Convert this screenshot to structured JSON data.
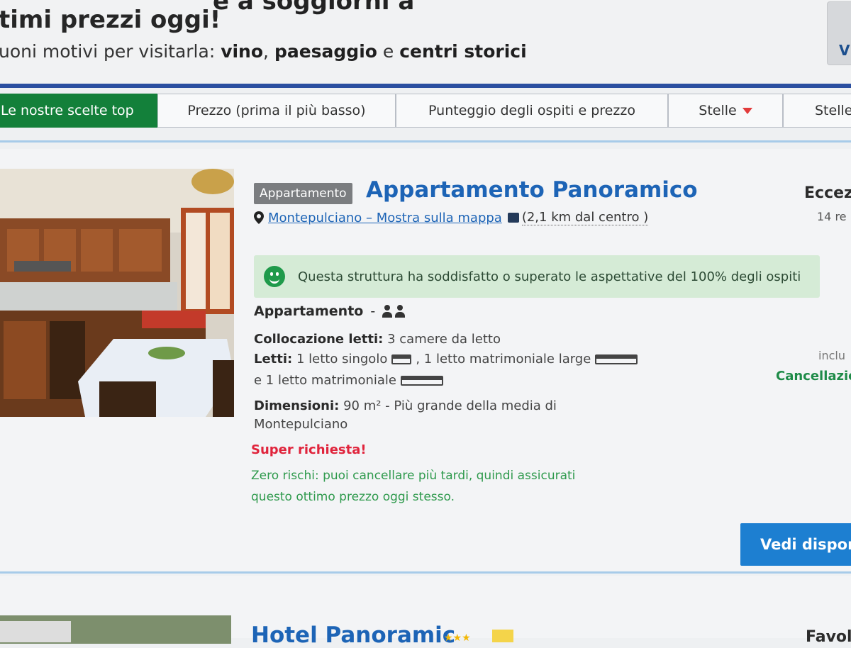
{
  "header": {
    "cut_line": "e a soggiorni a",
    "headline": "timi prezzi oggi!",
    "subline_prefix": "uoni motivi per visitarla: ",
    "sub_reasons": [
      "vino",
      "paesaggio",
      "centri storici"
    ],
    "sub_sep_1": ", ",
    "sub_sep_2": " e ",
    "map_letter": "V"
  },
  "tabs": [
    {
      "label": "Le nostre scelte top",
      "active": true
    },
    {
      "label": "Prezzo (prima il più basso)",
      "active": false
    },
    {
      "label": "Punteggio degli ospiti e prezzo",
      "active": false
    },
    {
      "label": "Stelle",
      "active": false,
      "has_caret": true
    },
    {
      "label": "Stelle",
      "active": false
    }
  ],
  "property": {
    "type_badge": "Appartamento",
    "title": "Appartamento Panoramico",
    "location_link": "Montepulciano – Mostra sulla mappa",
    "distance": "(2,1 km dal centro )",
    "score_word": "Eccez",
    "reviews": "14 re",
    "happy_message": "Questa struttura ha soddisfatto o superato le aspettative del 100% degli ospiti",
    "room_name": "Appartamento",
    "room_sep": "-",
    "bed_layout_label": "Collocazione letti:",
    "bed_layout_value": "3 camere da letto",
    "beds_label": "Letti:",
    "bed_1": "1 letto singolo",
    "bed_2": ", 1 letto matrimoniale large",
    "bed_3": "e 1 letto matrimoniale",
    "size_label": "Dimensioni:",
    "size_value": "90 m² - Più grande della media di",
    "size_value_2": "Montepulciano",
    "super_request": "Super richiesta!",
    "zero_risk_1": "Zero rischi: puoi cancellare più tardi, quindi assicurati",
    "zero_risk_2": "questo ottimo prezzo oggi stesso.",
    "included_text": "inclu",
    "cancellation": "Cancellazio",
    "cta": "Vedi dispon"
  },
  "next_property": {
    "title": "Hotel Panoramic",
    "stars": "★★★",
    "score_word": "Favol"
  },
  "colors": {
    "tab_active": "#13803a",
    "link_blue": "#1d64b6",
    "cta_blue": "#1d7fd1",
    "urgent_red": "#e0243c",
    "positive_green": "#2f9a4d",
    "tab_border_top": "#2b4fa0"
  }
}
